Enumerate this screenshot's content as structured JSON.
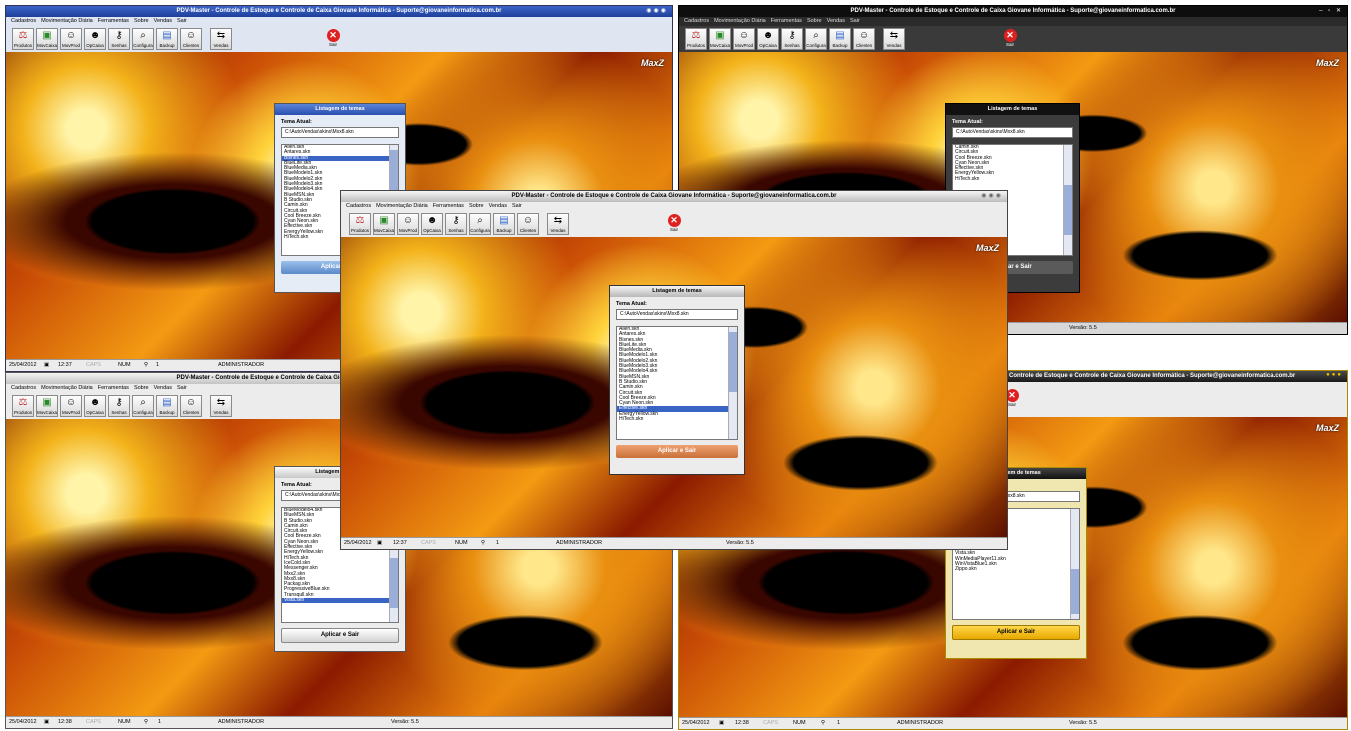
{
  "app_title": "PDV-Master - Controle de Estoque e Controle de Caixa Giovane Informática - Suporte@giovaneinformatica.com.br",
  "app_title_short": "Controle de Estoque e Controle de Caixa Giovane Informática - Suporte@giovaneinformatica.com.br",
  "menu": [
    "Cadastros",
    "Movimentação Diária",
    "Ferramentas",
    "Sobre",
    "Vendas",
    "Sair"
  ],
  "toolbar": [
    "Produtos",
    "MovCaixa",
    "MovProd",
    "OpCaixa",
    "Senhas",
    "Configura",
    "Backup",
    "Clientes",
    "Vendas"
  ],
  "toolbar_icons": [
    "scale-icon",
    "money-icon",
    "people-icon",
    "cashier-icon",
    "key-icon",
    "search-icon",
    "backup-icon",
    "clients-icon",
    "sales-icon"
  ],
  "exit_label": "Sair",
  "logo_text": "MaxZ",
  "status": {
    "date": "25/04/2012",
    "time1": "12:37",
    "time2": "12:38",
    "caps": "CAPS",
    "num": "NUM",
    "user_count": "1",
    "user": "ADMINISTRADOR",
    "version": "Versão: 5.5"
  },
  "dialog": {
    "title": "Listagem de temas",
    "label": "Tema Atual:",
    "path": "C:\\AutoVendas\\skins\\Mxx8.skn",
    "apply": "Aplicar e Sair"
  },
  "list_a": [
    "Alien.skn",
    "Antares.skn",
    "Bisnes.skn",
    "BlueLite.skn",
    "BlueMedia.skn",
    "BlueModelo1.skn",
    "BlueModelo2.skn",
    "BlueModelo3.skn",
    "BlueModelo4.skn",
    "BlueMSN.skn",
    "B Studio.skn",
    "Camin.skn",
    "Circuit.skn",
    "Cool Breeze.skn",
    "Cyan Neon.skn",
    "Effective.skn",
    "EnergyYellow.skn",
    "HiTech.skn"
  ],
  "list_b": [
    "Camin.skn",
    "Circuit.skn",
    "Cool Breeze.skn",
    "Cyan Neon.skn",
    "Effective.skn",
    "EnergyYellow.skn",
    "HiTech.skn"
  ],
  "list_c": [
    "BlueModelo4.skn",
    "BlueMSN.skn",
    "B Studio.skn",
    "Camin.skn",
    "Circuit.skn",
    "Cool Breeze.skn",
    "Cyan Neon.skn",
    "Effective.skn",
    "EnergyYellow.skn",
    "HiTech.skn",
    "IceCold.skn",
    "Messenger.skn",
    "Mxx2.skn",
    "Mxx8.skn",
    "Packag.skn",
    "ProgressiveBlue.skn",
    "Transqull.skn",
    "Vista.skn"
  ],
  "list_d": [
    "HiTech.skn",
    "IceCold.skn",
    "Messenger.skn",
    "Mxx2.skn",
    "Mxx8.skn",
    "Packag.skn",
    "ProgressiveBlue.skn",
    "Transqull.skn",
    "Vista.skn",
    "WinMediaPlayer11.skn",
    "WinVistaBlue1.skn",
    "Zippo.skn"
  ],
  "colors": {
    "blue_title": "#1e3f9a",
    "dark_title": "#1a1a1a",
    "yellow_title": "#f2c200",
    "orange_btn": "#d58a5c",
    "blue_btn": "#6a9ad0",
    "yellow_btn": "#f5bd16"
  }
}
